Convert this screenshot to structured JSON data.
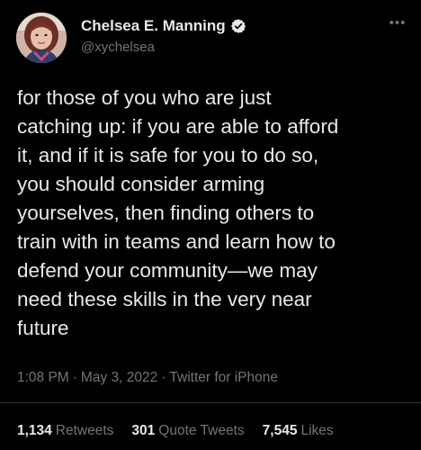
{
  "author": {
    "display_name": "Chelsea E. Manning",
    "handle": "@xychelsea",
    "verified": true
  },
  "tweet": {
    "lines": [
      "for those of you who are just",
      "catching up: if you are able to afford",
      "it, and if it is safe for you to do so,",
      "you should consider arming",
      "yourselves, then finding others to",
      "train with in teams and learn how to",
      "defend your community—we may",
      "need these skills in the very near",
      "future"
    ],
    "time": "1:08 PM",
    "date": "May 3, 2022",
    "source": "Twitter for iPhone",
    "separator": "·"
  },
  "stats": {
    "retweets": {
      "count": "1,134",
      "label": "Retweets"
    },
    "quote_tweets": {
      "count": "301",
      "label": "Quote Tweets"
    },
    "likes": {
      "count": "7,545",
      "label": "Likes"
    }
  },
  "menu": {
    "more_glyph": "•••"
  },
  "icons": {
    "verified": "verified-badge-icon",
    "more": "more-options-icon"
  },
  "colors": {
    "background": "#000000",
    "primary_text": "#e7e9ea",
    "secondary_text": "#71767b",
    "divider": "#2f3336"
  }
}
